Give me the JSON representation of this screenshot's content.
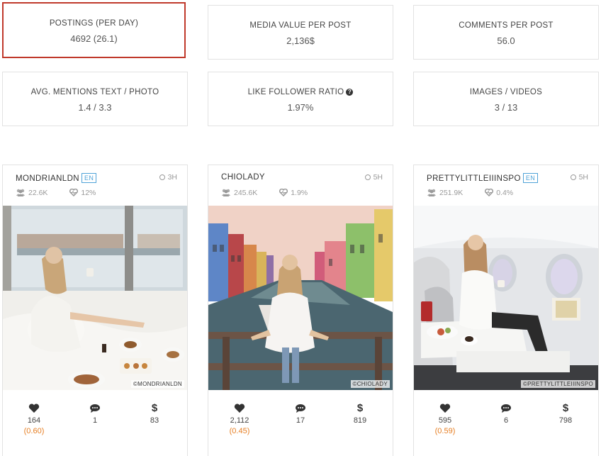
{
  "stats": [
    {
      "label": "POSTINGS (PER DAY)",
      "value": "4692 (26.1)"
    },
    {
      "label": "MEDIA VALUE PER POST",
      "value": "2,136$"
    },
    {
      "label": "COMMENTS PER POST",
      "value": "56.0"
    },
    {
      "label": "AVG. MENTIONS TEXT / PHOTO",
      "value": "1.4 / 3.3"
    },
    {
      "label": "LIKE FOLLOWER RATIO",
      "value": "1.97%"
    },
    {
      "label": "IMAGES / VIDEOS",
      "value": "3 / 13"
    }
  ],
  "posts": [
    {
      "username": "MONDRIANLDN",
      "lang": "EN",
      "time": "3H",
      "followers": "22.6K",
      "engagement": "12%",
      "credit": "©MONDRIANLDN",
      "likes": "164",
      "like_ratio": "(0.60)",
      "comments": "1",
      "value": "83"
    },
    {
      "username": "CHIOLADY",
      "lang": "",
      "time": "5H",
      "followers": "245.6K",
      "engagement": "1.9%",
      "credit": "©CHIOLADY",
      "likes": "2,112",
      "like_ratio": "(0.45)",
      "comments": "17",
      "value": "819"
    },
    {
      "username": "PRETTYLITTLEIIINSPO",
      "lang": "EN",
      "time": "5H",
      "followers": "251.9K",
      "engagement": "0.4%",
      "credit": "©PRETTYLITTLEIIINSPO",
      "likes": "595",
      "like_ratio": "(0.59)",
      "comments": "6",
      "value": "798"
    }
  ],
  "colors": {
    "active_border": "#c0392b",
    "accent": "#e67e22",
    "badge": "#4fa3d8"
  }
}
